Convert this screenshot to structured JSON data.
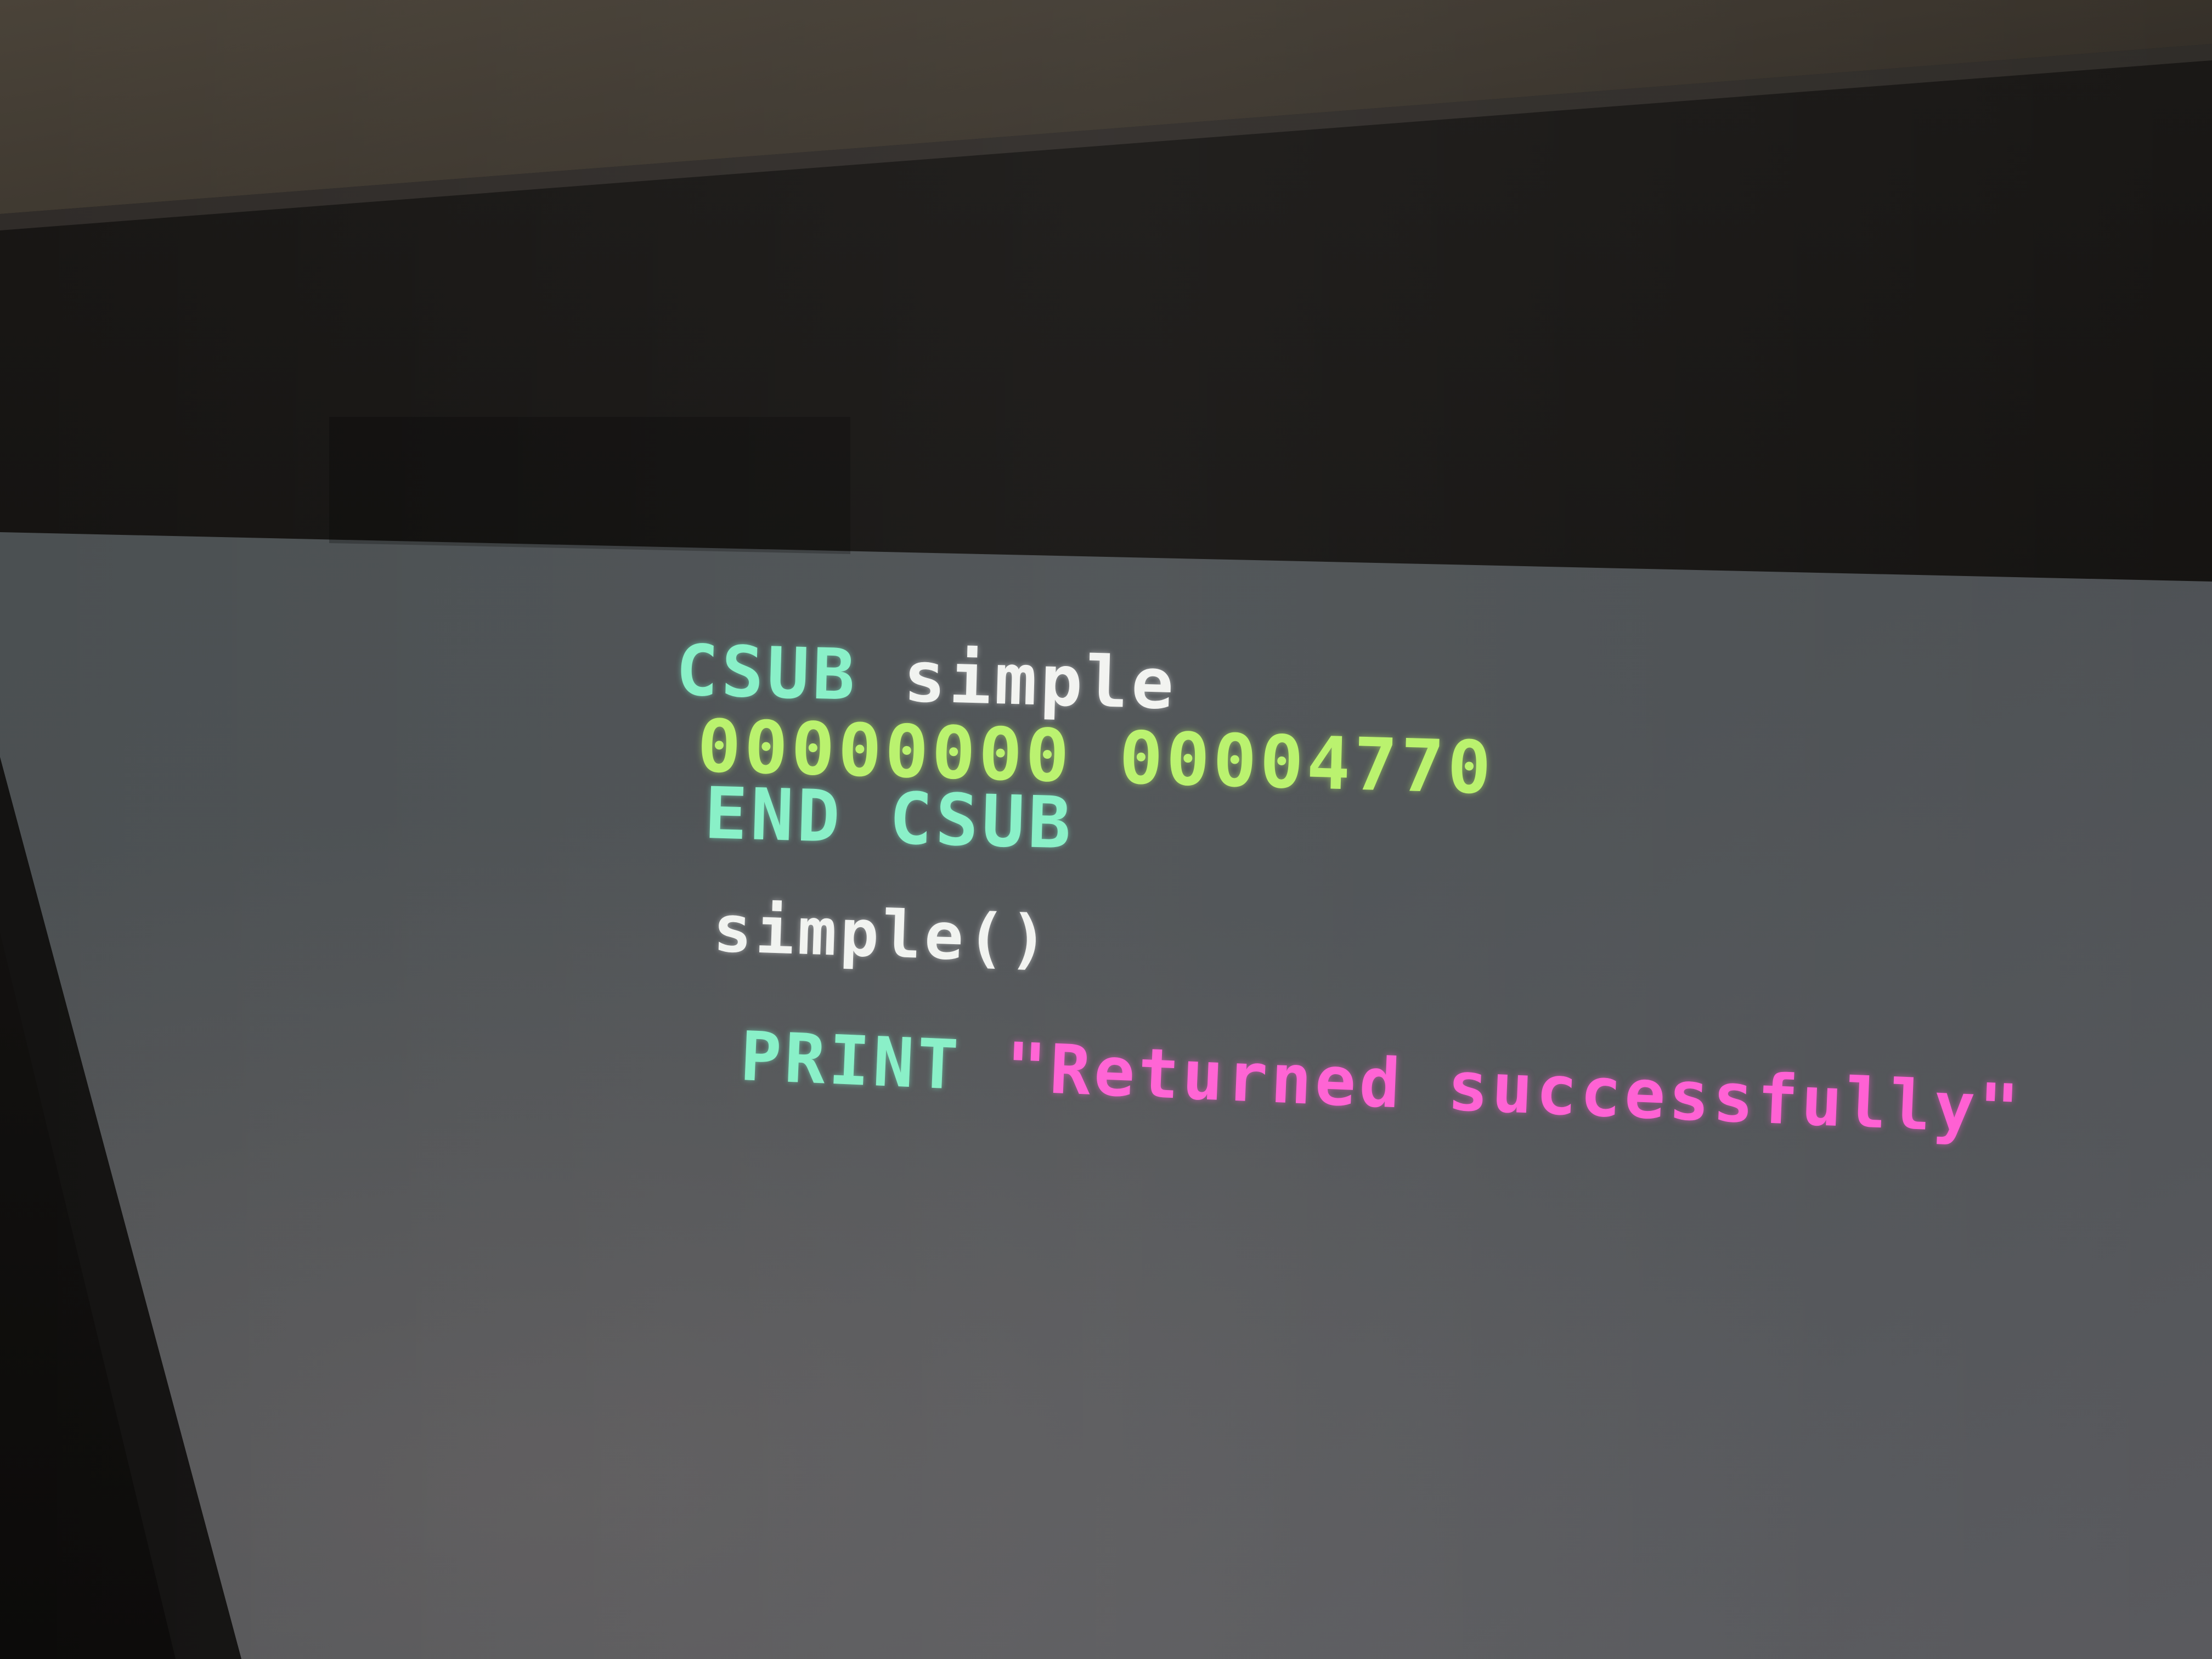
{
  "screen": {
    "lines": [
      {
        "keyword": "CSUB",
        "identifier": "simple"
      },
      {
        "hex1": "00000000",
        "hex2": "00004770"
      },
      {
        "keyword": "END CSUB"
      },
      {
        "call": "simple()"
      },
      {
        "keyword": "PRINT",
        "string": "\"Returned successfully\""
      }
    ]
  },
  "colors": {
    "keyword": "#86f0c6",
    "identifier": "#f1f3f0",
    "hex": "#b8f26a",
    "string": "#ff5fd3",
    "screen_background": "#4f5356"
  }
}
